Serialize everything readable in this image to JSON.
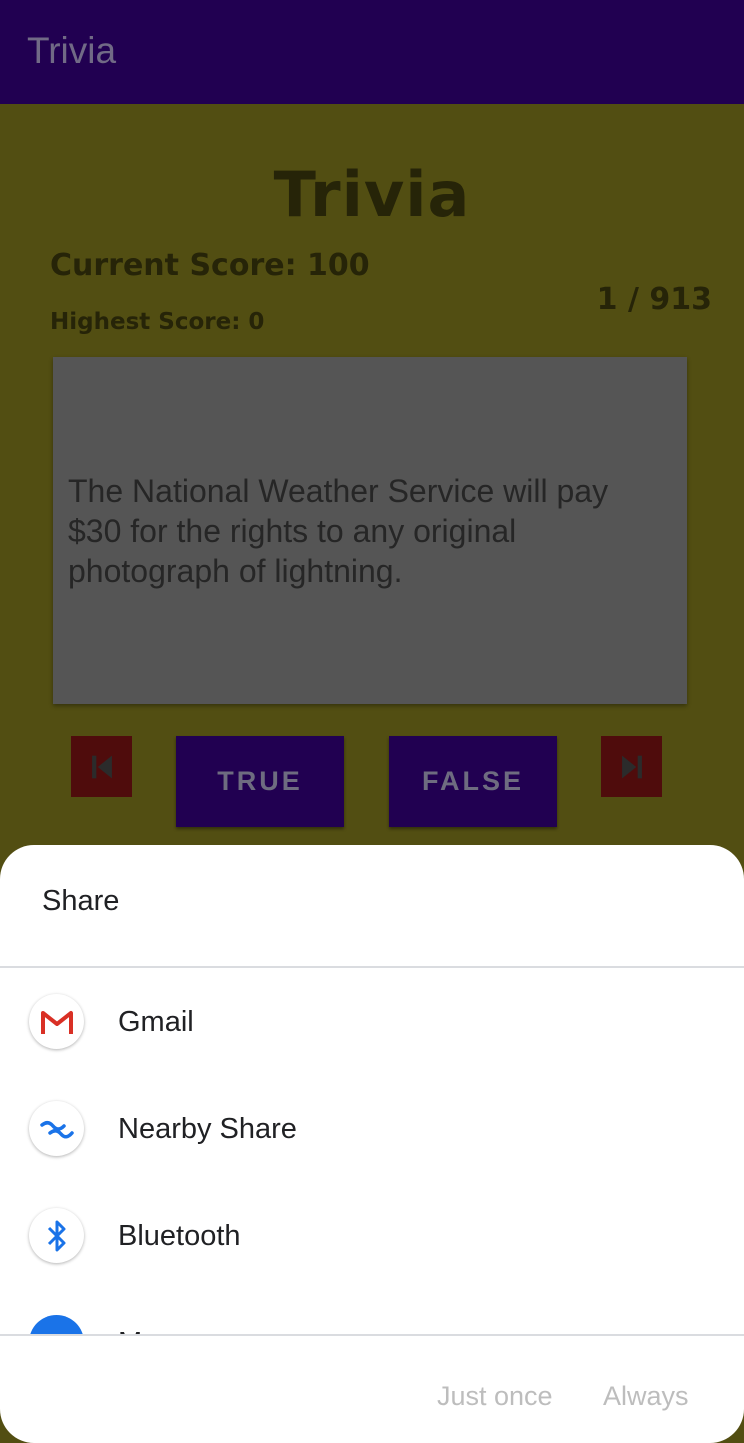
{
  "app_bar": {
    "title": "Trivia",
    "color": "#210051"
  },
  "game": {
    "title": "Trivia",
    "current_score": "Current Score: 100",
    "highest_score": "Highest Score: 0",
    "counter": "1 / 913",
    "question": "The National Weather Service will pay $30 for the rights to any original photograph of lightning.",
    "true_label": "TRUE",
    "false_label": "FALSE",
    "prev_icon": "skip-previous-icon",
    "next_icon": "skip-next-icon"
  },
  "share_sheet": {
    "title": "Share",
    "apps": [
      {
        "label": "Gmail",
        "icon": "gmail-icon"
      },
      {
        "label": "Nearby Share",
        "icon": "nearby-share-icon"
      },
      {
        "label": "Bluetooth",
        "icon": "bluetooth-icon"
      },
      {
        "label": "M",
        "icon": "messages-icon"
      }
    ],
    "just_once_label": "Just once",
    "always_label": "Always"
  }
}
